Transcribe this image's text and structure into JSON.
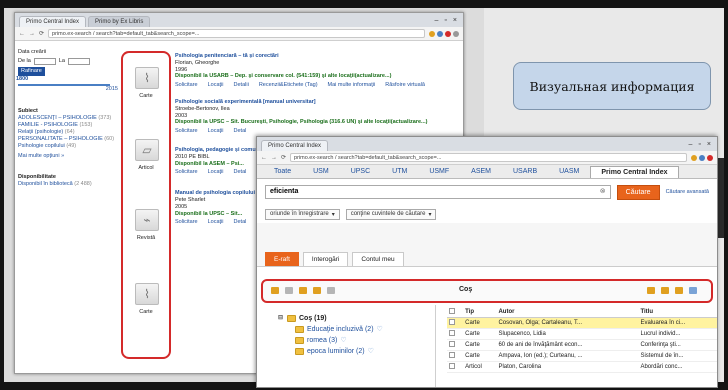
{
  "back_window": {
    "tabs": [
      "Primo Central Index",
      "Primo by Ex Libris"
    ],
    "address": "primo.ex-search / search?tab=default_tab&search_scope=...",
    "sidebar": {
      "date_label": "Data creării",
      "from_label": "De la",
      "to_label": "La",
      "refine_label": "Rafinare",
      "year_min": "1800",
      "year_max": "2015",
      "facet_title": "Subiect",
      "facets": [
        {
          "label": "ADOLESCENŢI – PSIHOLOGIE",
          "count": "(373)"
        },
        {
          "label": "FAMILIE - PSIHOLOGIE",
          "count": "(153)"
        },
        {
          "label": "Relaţii (psihologie)",
          "count": "(64)"
        },
        {
          "label": "PERSONALITATE – PSIHOLOGIE",
          "count": "(60)"
        },
        {
          "label": "Psihologie copilului",
          "count": "(49)"
        }
      ],
      "more_label": "Mai multe opţiuni »",
      "availability_title": "Disponibilitate",
      "availability_item": "Disponibil în bibliotecă",
      "availability_count": "(2 488)"
    },
    "types": [
      "Carte",
      "Articol",
      "Revistă",
      "Carte"
    ],
    "results": [
      {
        "title": "Psihologia penitenciară – tă și corectări",
        "author": "Florian, Gheorghe",
        "year": "1996",
        "avail": "Disponibil la USARB – Dep. şi conservare col. (541:159) şi alte locaţii(actualizare...)",
        "links": [
          "Solicitare",
          "Locaţii",
          "Detalii",
          "Recenzii&Etichete (Tag)",
          "Mai multe informaţii",
          "Răsfoire virtuală"
        ]
      },
      {
        "title": "Psihologie socială experimentală [manual universitar]",
        "author": "Stroebe-Bertonov, Ilea",
        "year": "2003",
        "avail": "Disponibil la UPSC – Sit. Bucureşti, Psihologie, Psihologia (316.6 UN) şi alte locaţii(actualizare...)",
        "links": [
          "Solicitare",
          "Locaţii",
          "Detal"
        ]
      },
      {
        "title": "Psihologia, pedagogie și comunicare",
        "author": "",
        "year": "2010 PE BIBL",
        "avail": "Disponibil la ASEM – Psi...",
        "links": [
          "Solicitare",
          "Locaţii",
          "Detal"
        ]
      },
      {
        "title": "Manual de psihologia copilului",
        "author": "Pete Sharlet",
        "year": "2005",
        "avail": "Disponibil la UPSC – Sit...",
        "links": [
          "Solicitare",
          "Locaţii",
          "Detal"
        ]
      }
    ]
  },
  "front_window": {
    "nav_tabs": [
      "Toate",
      "USM",
      "UPSC",
      "UTM",
      "USMF",
      "ASEM",
      "USARB",
      "UASM",
      "Primo Central Index"
    ],
    "search_value": "eficienta",
    "search_button": "Căutare",
    "advanced": "Căutare avansată",
    "filter1": "oriunde în înregistrare",
    "filter2": "conţine cuvintele de căutare",
    "subtabs": [
      "E-raft",
      "Interogări",
      "Contul meu"
    ],
    "cart_title": "Coş",
    "tree_root": "Coş (19)",
    "tree_children": [
      "Educaţie incluzivă (2)",
      "romea (3)",
      "epoca luminilor (2)"
    ],
    "table_headers": [
      "",
      "Tip",
      "Autor",
      "Titlu"
    ],
    "table_rows": [
      {
        "tip": "Carte",
        "autor": "Cosovan, Olga; Cartaleanu, T...",
        "titlu": "Evaluarea în ci...",
        "highlight": true
      },
      {
        "tip": "Carte",
        "autor": "Slupacenco, Lidia",
        "titlu": "Lucrul individ...",
        "highlight": false
      },
      {
        "tip": "Carte",
        "autor": "60 de ani de învăţământ econ...",
        "titlu": "Conferinţa şti...",
        "highlight": false
      },
      {
        "tip": "Carte",
        "autor": "Ampava, Ion (ed.); Curteanu, ...",
        "titlu": "Sistemul de în...",
        "highlight": false
      },
      {
        "tip": "Articol",
        "autor": "Platon, Carolina",
        "titlu": "Abordări conc...",
        "highlight": false
      }
    ]
  },
  "infobox": {
    "text": "Визуальная информация"
  },
  "colors": {
    "highlight_red": "#d42a2a",
    "accent_orange": "#e8641c",
    "link_blue": "#1e4f9c",
    "infobox_bg": "#c5d6ea"
  }
}
